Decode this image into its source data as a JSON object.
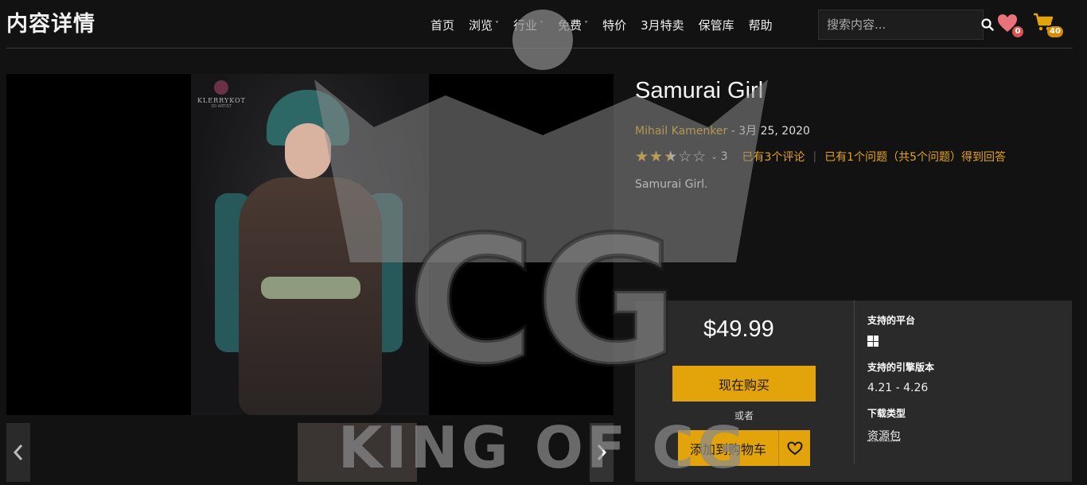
{
  "header": {
    "page_title": "内容详情",
    "nav": [
      {
        "label": "首页",
        "dropdown": false
      },
      {
        "label": "浏览",
        "dropdown": true
      },
      {
        "label": "行业",
        "dropdown": true
      },
      {
        "label": "免费",
        "dropdown": true
      },
      {
        "label": "特价",
        "dropdown": false
      },
      {
        "label": "3月特卖",
        "dropdown": false
      },
      {
        "label": "保管库",
        "dropdown": false
      },
      {
        "label": "帮助",
        "dropdown": false
      }
    ],
    "search": {
      "placeholder": "搜索内容..."
    },
    "wishlist_count": "0",
    "cart_count": "40"
  },
  "media": {
    "brand": "KLERRYKOT",
    "brand_sub": "3D ARTIST"
  },
  "product": {
    "title": "Samurai Girl",
    "author": "Mihail Kamenker",
    "date": " - 3月 25, 2020",
    "rating": 2.5,
    "rating_max": 5,
    "rating_count": "3",
    "review_link": "已有3个评论",
    "qa_link": "已有1个问题（共5个问题）得到回答",
    "description": "Samurai Girl."
  },
  "purchase": {
    "price": "$49.99",
    "buy_label": "现在购买",
    "or_label": "或者",
    "add_cart_label": "添加到购物车",
    "platforms_label": "支持的平台",
    "platform_icon": "windows-icon",
    "engine_label": "支持的引擎版本",
    "engine_value": "4.21 - 4.26",
    "download_label": "下载类型",
    "download_value": "资源包"
  },
  "watermark": {
    "text": "KING OF CG",
    "mark": "CG"
  },
  "colors": {
    "accent": "#e3a30b",
    "link": "#e6a418",
    "background": "#121212",
    "panel": "#2a2a2a"
  }
}
